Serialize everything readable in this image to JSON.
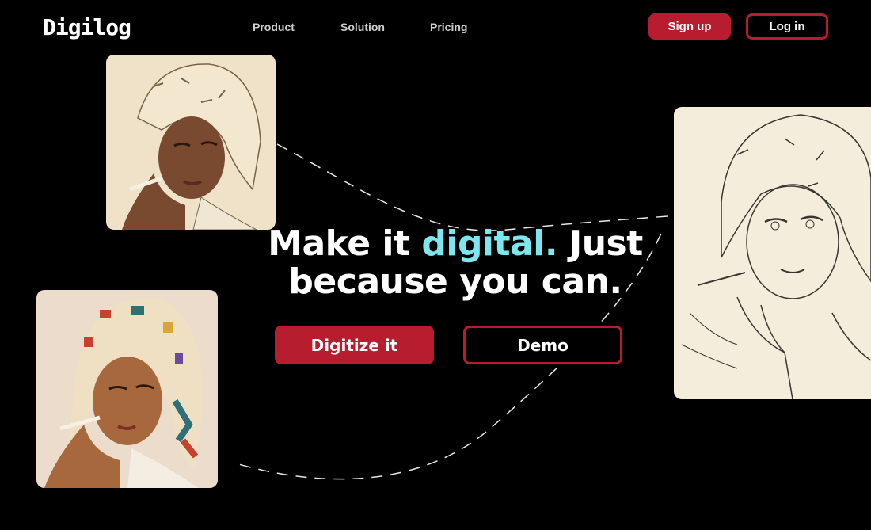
{
  "brand": {
    "logo_text": "Digilog"
  },
  "nav": {
    "items": [
      "Product",
      "Solution",
      "Pricing"
    ]
  },
  "auth": {
    "signup_label": "Sign up",
    "login_label": "Log in"
  },
  "hero": {
    "headline_part1": "Make it ",
    "headline_accent": "digital.",
    "headline_part2": " Just",
    "headline_line2": "because you can.",
    "primary_cta": "Digitize it",
    "secondary_cta": "Demo"
  },
  "colors": {
    "accent_red": "#b71c2f",
    "accent_cyan": "#7de6ee",
    "background": "#000000"
  }
}
